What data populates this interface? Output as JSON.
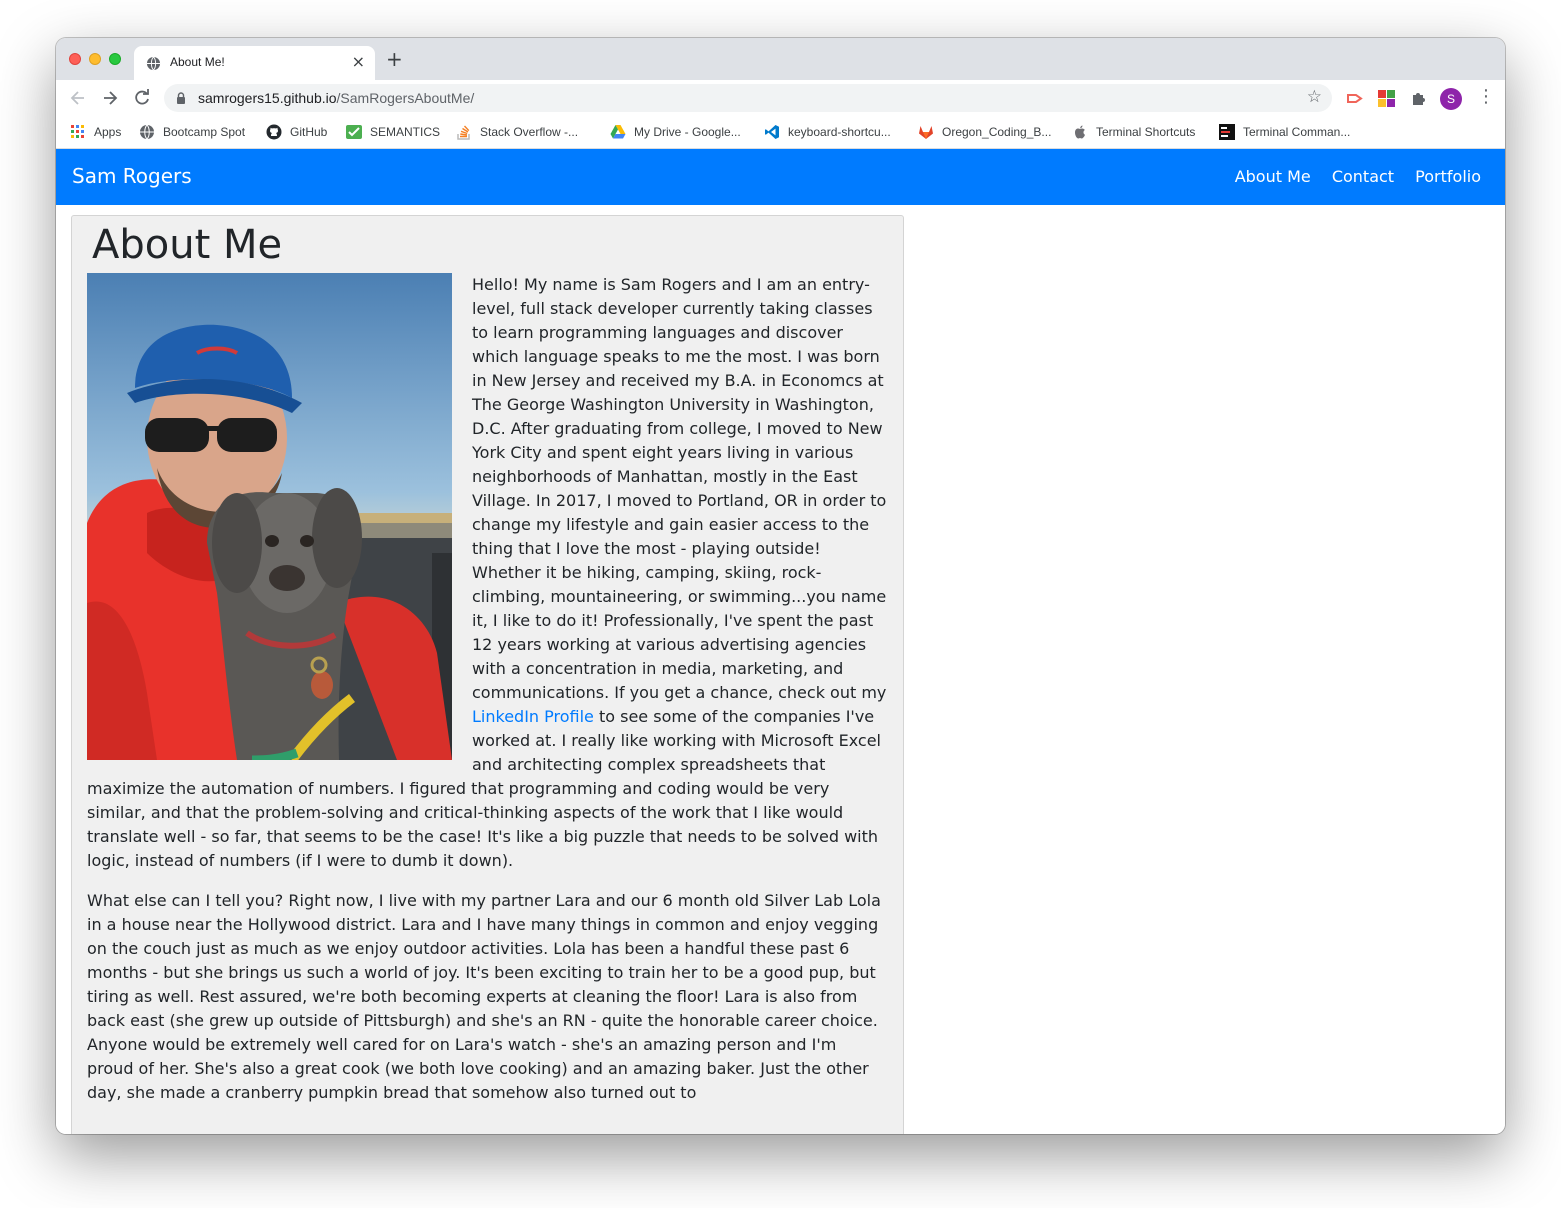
{
  "browser": {
    "tab_title": "About Me!",
    "tab_close": "×",
    "new_tab": "+",
    "url_host": "samrogers15.github.io",
    "url_path": "/SamRogersAboutMe/",
    "star": "☆",
    "profile_initial": "S",
    "menu": "⋮",
    "bookmarks": [
      {
        "label": "Apps",
        "icon": "apps-grid-icon"
      },
      {
        "label": "Bootcamp Spot",
        "icon": "globe-icon"
      },
      {
        "label": "GitHub",
        "icon": "github-icon"
      },
      {
        "label": "SEMANTICS",
        "icon": "semantics-icon"
      },
      {
        "label": "Stack Overflow -...",
        "icon": "stackoverflow-icon"
      },
      {
        "label": "My Drive - Google...",
        "icon": "google-drive-icon"
      },
      {
        "label": "keyboard-shortcu...",
        "icon": "vscode-icon"
      },
      {
        "label": "Oregon_Coding_B...",
        "icon": "gitlab-icon"
      },
      {
        "label": "Terminal Shortcuts",
        "icon": "apple-icon"
      },
      {
        "label": "Terminal Comman...",
        "icon": "terminal-icon"
      }
    ]
  },
  "site": {
    "brand": "Sam Rogers",
    "nav": [
      "About Me",
      "Contact",
      "Portfolio"
    ],
    "colors": {
      "navbar": "#007bff",
      "link": "#007bff",
      "card": "#f0f0f0"
    }
  },
  "about": {
    "heading": "About Me",
    "p1_before_link": "Hello! My name is Sam Rogers and I am an entry-level, full stack developer currently taking classes to learn programming languages and discover which language speaks to me the most. I was born in New Jersey and received my B.A. in Economcs at The George Washington University in Washington, D.C. After graduating from college, I moved to New York City and spent eight years living in various neighborhoods of Manhattan, mostly in the East Village. In 2017, I moved to Portland, OR in order to change my lifestyle and gain easier access to the thing that I love the most - playing outside! Whether it be hiking, camping, skiing, rock-climbing, mountaineering, or swimming...you name it, I like to do it! Professionally, I've spent the past 12 years working at various advertising agencies with a concentration in media, marketing, and communications. If you get a chance, check out my ",
    "link_text": "LinkedIn Profile",
    "p1_after_link": " to see some of the companies I've worked at. I really like working with Microsoft Excel and architecting complex spreadsheets that maximize the automation of numbers. I figured that programming and coding would be very similar, and that the problem-solving and critical-thinking aspects of the work that I like would translate well - so far, that seems to be the case! It's like a big puzzle that needs to be solved with logic, instead of numbers (if I were to dumb it down).",
    "p2": "What else can I tell you? Right now, I live with my partner Lara and our 6 month old Silver Lab Lola in a house near the Hollywood district. Lara and I have many things in common and enjoy vegging on the couch just as much as we enjoy outdoor activities. Lola has been a handful these past 6 months - but she brings us such a world of joy. It's been exciting to train her to be a good pup, but tiring as well. Rest assured, we're both becoming experts at cleaning the floor! Lara is also from back east (she grew up outside of Pittsburgh) and she's an RN - quite the honorable career choice. Anyone would be extremely well cared for on Lara's watch - she's an amazing person and I'm proud of her. She's also a great cook (we both love cooking) and an amazing baker. Just the other day, she made a cranberry pumpkin bread that somehow also turned out to"
  }
}
